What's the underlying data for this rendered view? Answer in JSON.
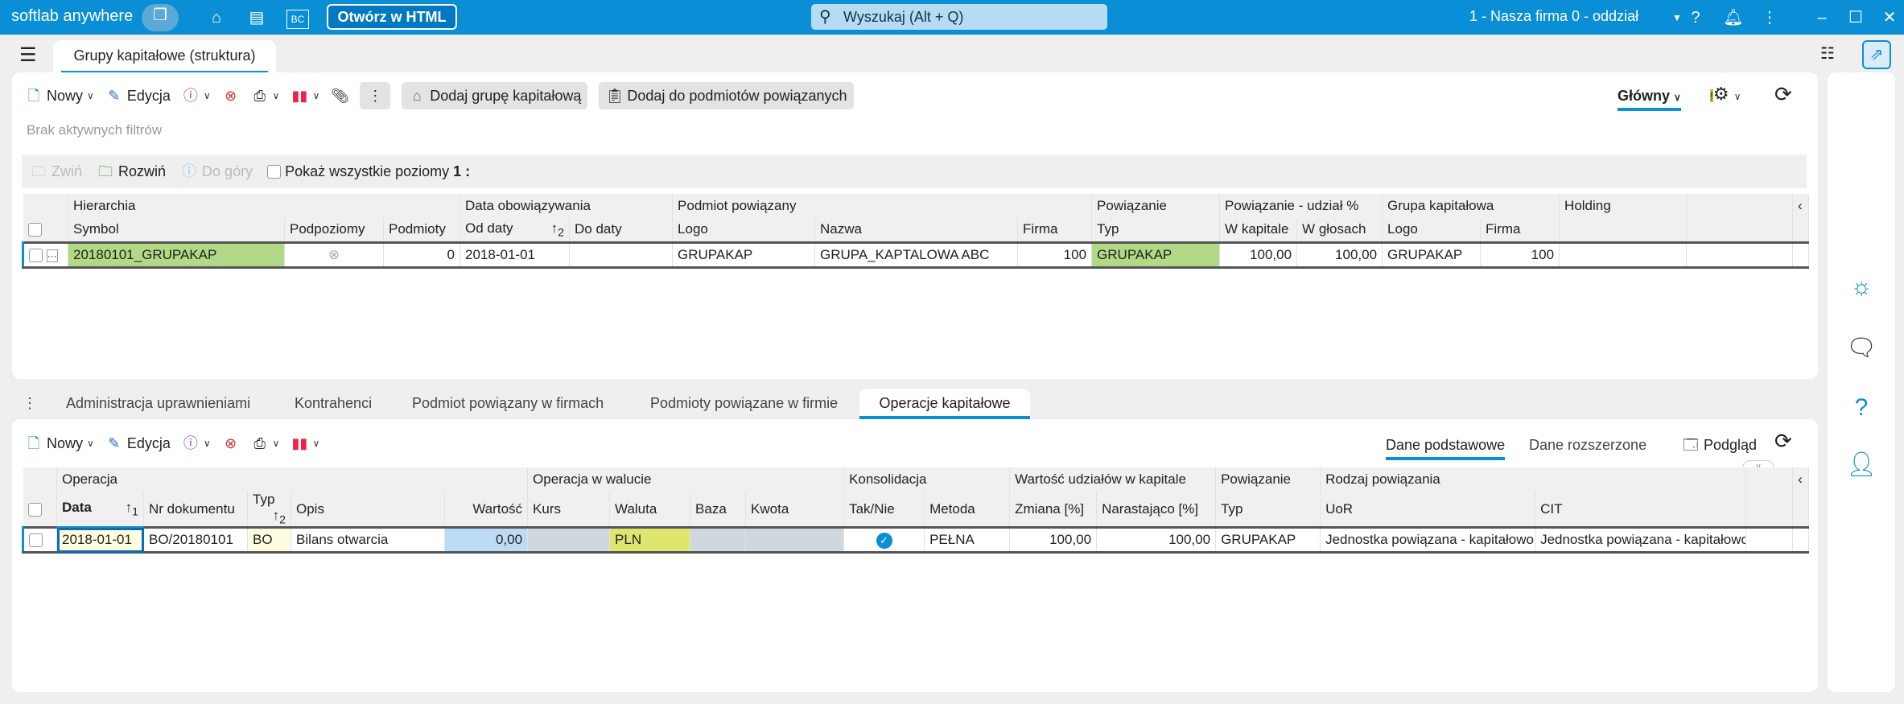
{
  "app": {
    "brand": "softlab anywhere",
    "open_html": "Otwórz w HTML",
    "search_placeholder": "Wyszukaj (Alt + Q)",
    "company": "1 - Nasza firma 0 - oddział"
  },
  "doc_tab": "Grupy kapitałowe (struktura)",
  "top_toolbar": {
    "new": "Nowy",
    "edit": "Edycja",
    "add_group": "Dodaj grupę kapitałową",
    "add_related": "Dodaj do podmiotów powiązanych",
    "view": "Główny"
  },
  "filters": "Brak aktywnych filtrów",
  "tree_toolbar": {
    "collapse": "Zwiń",
    "expand": "Rozwiń",
    "up": "Do góry",
    "show_all": "Pokaż wszystkie poziomy",
    "level": "1 :"
  },
  "top_grid": {
    "groups": [
      "Hierarchia",
      "Data obowiązywania",
      "Podmiot powiązany",
      "Powiązanie",
      "Powiązanie - udział %",
      "Grupa kapitałowa",
      "Holding"
    ],
    "columns": [
      "Symbol",
      "Podpoziomy",
      "Podmioty",
      "Od daty",
      "Do daty",
      "Logo",
      "Nazwa",
      "Firma",
      "Typ",
      "W kapitale",
      "W głosach",
      "Logo",
      "Firma"
    ],
    "sort_index": "2",
    "row": {
      "symbol": "20180101_GRUPAKAP",
      "podmioty": "0",
      "od": "2018-01-01",
      "do": "",
      "logo": "GRUPAKAP",
      "nazwa": "GRUPA_KAPTALOWA ABC",
      "firma": "100",
      "typ": "GRUPAKAP",
      "w_kapitale": "100,00",
      "w_glosach": "100,00",
      "gk_logo": "GRUPAKAP",
      "gk_firma": "100"
    }
  },
  "sub_tabs": [
    "Administracja uprawnieniami",
    "Kontrahenci",
    "Podmiot powiązany w firmach",
    "Podmioty powiązane w firmie",
    "Operacje kapitałowe"
  ],
  "bottom_toolbar": {
    "new": "Nowy",
    "edit": "Edycja",
    "basic": "Dane podstawowe",
    "extended": "Dane rozszerzone",
    "preview": "Podgląd"
  },
  "bottom_grid": {
    "groups": [
      "Operacja",
      "Operacja w walucie",
      "Konsolidacja",
      "Wartość udziałów w kapitale",
      "Powiązanie",
      "Rodzaj powiązania"
    ],
    "columns": [
      "Data",
      "Nr dokumentu",
      "Typ",
      "Opis",
      "Wartość",
      "Kurs",
      "Waluta",
      "Baza",
      "Kwota",
      "Tak/Nie",
      "Metoda",
      "Zmiana [%]",
      "Narastająco [%]",
      "Typ",
      "UoR",
      "CIT"
    ],
    "sort1": "1",
    "sort2": "2",
    "row": {
      "data": "2018-01-01",
      "nr": "BO/20180101",
      "typ": "BO",
      "opis": "Bilans otwarcia",
      "wartosc": "0,00",
      "kurs": "",
      "waluta": "PLN",
      "baza": "",
      "kwota": "",
      "metoda": "PEŁNA",
      "zmiana": "100,00",
      "narast": "100,00",
      "pow_typ": "GRUPAKAP",
      "uor": "Jednostka powiązana - kapitałowo",
      "cit": "Jednostka powiązana - kapitałowo"
    }
  },
  "colors": {
    "accent": "#0a8fd6",
    "green": "#b2d986",
    "yellow": "#dfe66e",
    "blue_cell": "#bcdcf5"
  }
}
